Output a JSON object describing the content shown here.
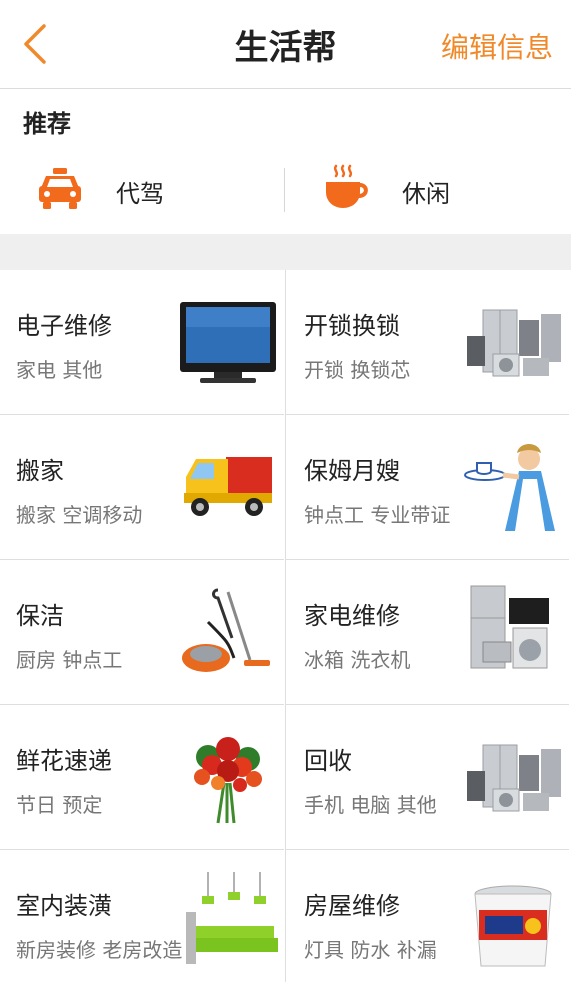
{
  "header": {
    "title": "生活帮",
    "edit_label": "编辑信息"
  },
  "recommend": {
    "title": "推荐",
    "items": [
      {
        "label": "代驾",
        "icon": "taxi-icon"
      },
      {
        "label": "休闲",
        "icon": "coffee-cup-icon"
      }
    ]
  },
  "services": [
    {
      "name": "电子维修",
      "sub": "家电 其他",
      "icon": "tv-icon"
    },
    {
      "name": "开锁换锁",
      "sub": "开锁 换锁芯",
      "icon": "appliances-icon"
    },
    {
      "name": "搬家",
      "sub": "搬家 空调移动",
      "icon": "truck-icon"
    },
    {
      "name": "保姆月嫂",
      "sub": "钟点工 专业带证",
      "icon": "maid-icon"
    },
    {
      "name": "保洁",
      "sub": "厨房 钟点工",
      "icon": "vacuum-icon"
    },
    {
      "name": "家电维修",
      "sub": "冰箱 洗衣机",
      "icon": "fridge-washer-icon"
    },
    {
      "name": "鲜花速递",
      "sub": "节日 预定",
      "icon": "flower-bouquet-icon"
    },
    {
      "name": "回收",
      "sub": "手机 电脑 其他",
      "icon": "appliances-icon"
    },
    {
      "name": "室内装潢",
      "sub": "新房装修 老房改造",
      "icon": "green-sofa-icon"
    },
    {
      "name": "房屋维修",
      "sub": "灯具 防水 补漏",
      "icon": "paint-bucket-icon"
    }
  ],
  "colors": {
    "accent": "#f0892a",
    "icon_orange": "#f26a1b"
  }
}
